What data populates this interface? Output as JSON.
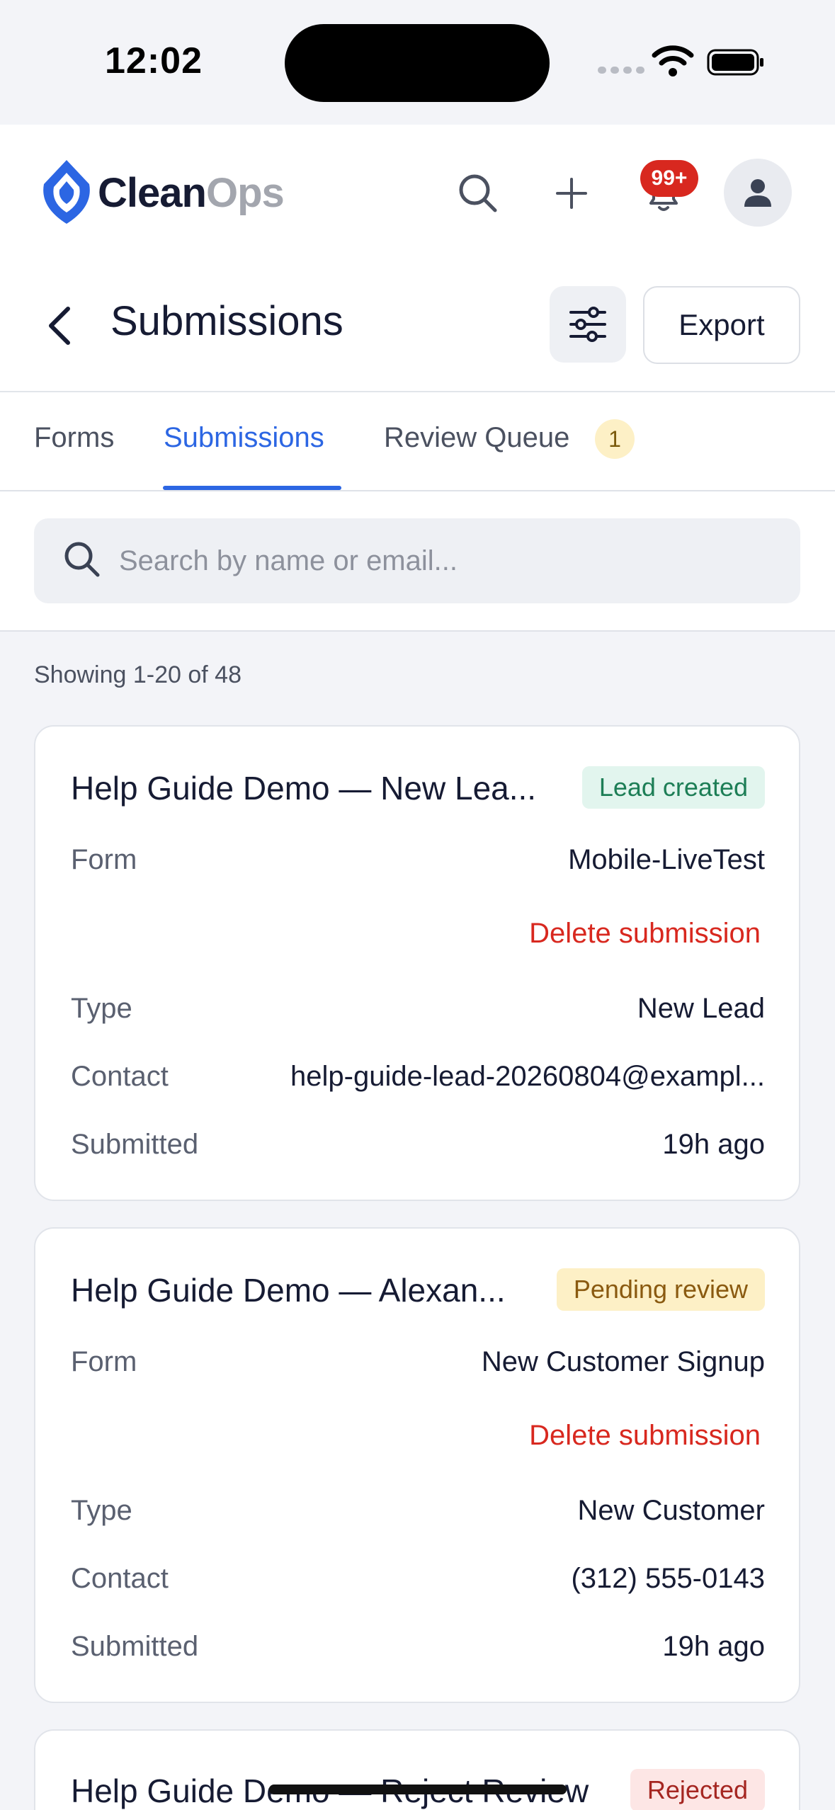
{
  "status": {
    "time": "12:02"
  },
  "header": {
    "logo_part1": "Clean",
    "logo_part2": "Ops",
    "notifications_badge": "99+",
    "page_title": "Submissions",
    "export_label": "Export"
  },
  "tabs": [
    {
      "label": "Forms",
      "active": false
    },
    {
      "label": "Submissions",
      "active": true
    },
    {
      "label": "Review Queue",
      "active": false,
      "count": "1"
    }
  ],
  "search": {
    "placeholder": "Search by name or email..."
  },
  "showing": "Showing 1-20 of 48",
  "labels": {
    "form": "Form",
    "type": "Type",
    "contact": "Contact",
    "submitted": "Submitted",
    "delete": "Delete submission"
  },
  "submissions": [
    {
      "title": "Help Guide Demo — New Lea...",
      "status": "Lead created",
      "form": "Mobile-LiveTest",
      "type": "New Lead",
      "contact": "help-guide-lead-20260804@exampl...",
      "submitted": "19h ago"
    },
    {
      "title": "Help Guide Demo — Alexan...",
      "status": "Pending review",
      "form": "New Customer Signup",
      "type": "New Customer",
      "contact": "(312) 555-0143",
      "submitted": "19h ago"
    },
    {
      "title": "Help Guide Demo — Reject Review",
      "status": "Rejected"
    }
  ],
  "colors": {
    "accent": "#2c66e3",
    "danger": "#d8281f",
    "logo_blue": "#2c66e3"
  }
}
